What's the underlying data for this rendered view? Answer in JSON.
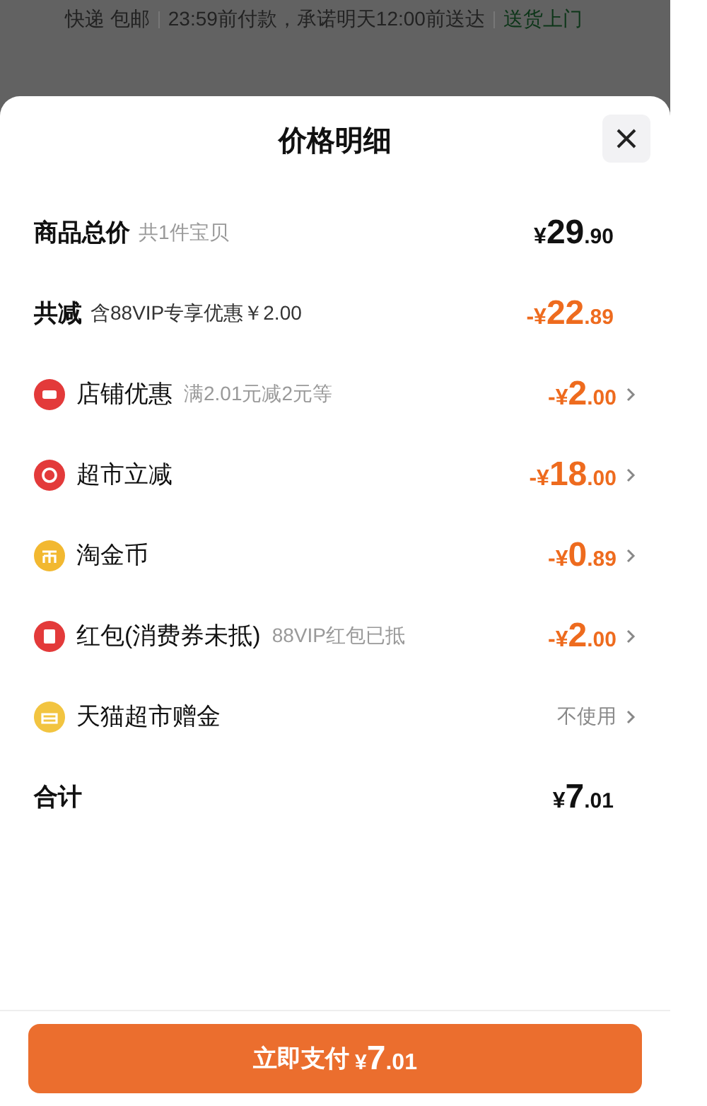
{
  "background": {
    "segments": [
      {
        "text": "快递 包邮",
        "kind": "plain"
      },
      {
        "text": "23:59前付款，承诺明天12:00前送达",
        "kind": "plain"
      },
      {
        "text": "送货上门",
        "kind": "highlight"
      }
    ]
  },
  "sheet": {
    "title": "价格明细",
    "summary": [
      {
        "label": "商品总价",
        "note": "共1件宝贝",
        "price": {
          "sign": "¥",
          "int": "29",
          "dec": ".90"
        },
        "kind": "total"
      },
      {
        "label": "共减",
        "note": "含88VIP专享优惠￥2.00",
        "price": {
          "sign": "-¥",
          "int": "22",
          "dec": ".89"
        },
        "kind": "discount"
      }
    ],
    "items": [
      {
        "kind": "shop",
        "color": "#e33a3a",
        "label": "店铺优惠",
        "note": "满2.01元减2元等",
        "price": {
          "sign": "-¥",
          "int": "2",
          "dec": ".00"
        }
      },
      {
        "kind": "market",
        "color": "#e33a3a",
        "label": "超市立减",
        "price": {
          "sign": "-¥",
          "int": "18",
          "dec": ".00"
        }
      },
      {
        "kind": "coin",
        "color": "#f2b830",
        "label": "淘金币",
        "price": {
          "sign": "-¥",
          "int": "0",
          "dec": ".89"
        }
      },
      {
        "kind": "packet",
        "color": "#e33a3a",
        "label": "红包(消费券未抵)",
        "note": "88VIP红包已抵",
        "price": {
          "sign": "-¥",
          "int": "2",
          "dec": ".00"
        }
      },
      {
        "kind": "gift",
        "color": "#f2c440",
        "label": "天猫超市赠金",
        "status": "不使用"
      }
    ],
    "total": {
      "label": "合计",
      "price": {
        "sign": "¥",
        "int": "7",
        "dec": ".01"
      }
    },
    "pay": {
      "label": "立即支付",
      "price": {
        "sign": "¥",
        "int": "7",
        "dec": ".01"
      }
    }
  }
}
